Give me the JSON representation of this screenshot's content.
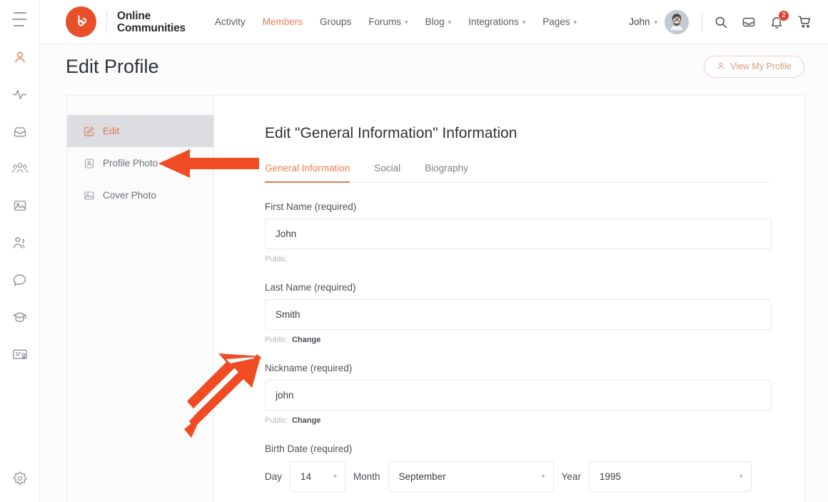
{
  "rail": {
    "burger": "menu-icon",
    "items": [
      {
        "name": "profile",
        "icon": "person-icon",
        "active": true
      },
      {
        "name": "activity",
        "icon": "pulse-icon",
        "active": false
      },
      {
        "name": "messages",
        "icon": "inbox-icon",
        "active": false
      },
      {
        "name": "groups",
        "icon": "groups-icon",
        "active": false
      },
      {
        "name": "media",
        "icon": "image-icon",
        "active": false
      },
      {
        "name": "members",
        "icon": "people-icon",
        "active": false
      },
      {
        "name": "forums",
        "icon": "chat-icon",
        "active": false
      },
      {
        "name": "courses",
        "icon": "graduation-cap-icon",
        "active": false
      },
      {
        "name": "certificates",
        "icon": "certificate-icon",
        "active": false
      }
    ],
    "settings_icon": "gear-icon"
  },
  "header": {
    "brand_line1": "Online",
    "brand_line2": "Communities",
    "logo_icon": "buddyboss-logo-icon",
    "nav": [
      {
        "label": "Activity",
        "has_caret": false,
        "active": false
      },
      {
        "label": "Members",
        "has_caret": false,
        "active": true
      },
      {
        "label": "Groups",
        "has_caret": false,
        "active": false
      },
      {
        "label": "Forums",
        "has_caret": true,
        "active": false
      },
      {
        "label": "Blog",
        "has_caret": true,
        "active": false
      },
      {
        "label": "Integrations",
        "has_caret": true,
        "active": false
      },
      {
        "label": "Pages",
        "has_caret": true,
        "active": false
      }
    ],
    "user_name": "John",
    "user_caret": "chevron-down-icon",
    "avatar": "user-avatar",
    "icons": [
      {
        "name": "search-icon",
        "badge": ""
      },
      {
        "name": "inbox-icon",
        "badge": ""
      },
      {
        "name": "notifications-bell-icon",
        "badge": "2"
      },
      {
        "name": "cart-icon",
        "badge": ""
      }
    ]
  },
  "titlebar": {
    "title": "Edit Profile",
    "view_profile_label": "View My Profile",
    "view_profile_icon": "person-icon"
  },
  "side_nav": {
    "items": [
      {
        "label": "Edit",
        "icon": "edit-pencil-icon",
        "active": true
      },
      {
        "label": "Profile Photo",
        "icon": "profile-photo-icon",
        "active": false
      },
      {
        "label": "Cover Photo",
        "icon": "cover-photo-icon",
        "active": false
      }
    ]
  },
  "main": {
    "heading": "Edit \"General Information\" Information",
    "tabs": [
      {
        "label": "General Information",
        "active": true
      },
      {
        "label": "Social",
        "active": false
      },
      {
        "label": "Biography",
        "active": false
      }
    ],
    "fields": [
      {
        "label": "First Name (required)",
        "value": "John",
        "placeholder": "First Name",
        "visibility": "Public",
        "change_label": ""
      },
      {
        "label": "Last Name (required)",
        "value": "Smith",
        "placeholder": "Last Name",
        "visibility": "Public",
        "change_label": "Change"
      },
      {
        "label": "Nickname (required)",
        "value": "john",
        "placeholder": "Nickname",
        "visibility": "Public",
        "change_label": "Change"
      }
    ],
    "birth_date": {
      "label": "Birth Date (required)",
      "day_label": "Day",
      "day_value": "14",
      "month_label": "Month",
      "month_value": "September",
      "year_label": "Year",
      "year_value": "1995"
    }
  },
  "annotations": {
    "arrow_color": "#f04b22",
    "arrow_1": "points-left-to-profile-photo",
    "arrow_2": "points-up-right-to-change-link"
  }
}
